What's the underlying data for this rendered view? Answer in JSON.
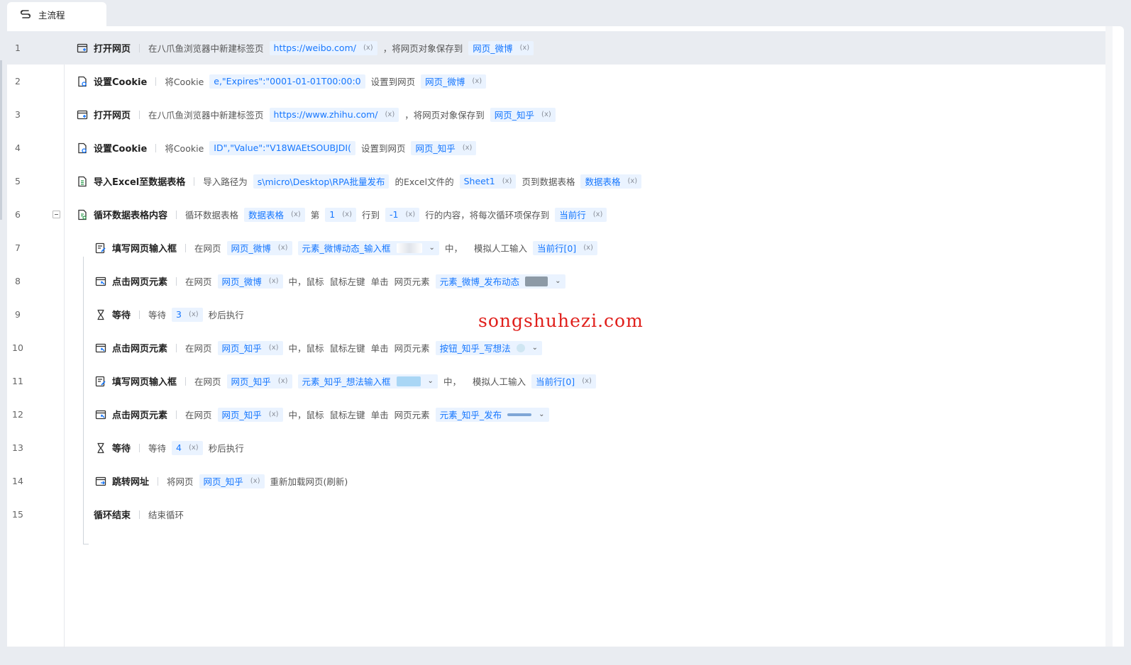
{
  "tab": {
    "label": "主流程"
  },
  "watermark": "songshuhezi.com",
  "rows": [
    {
      "num": "1",
      "title": "打开网页",
      "icon": "open-webpage-icon",
      "selected": true,
      "p1": "在八爪鱼浏览器中新建标签页",
      "c1": "https://weibo.com/",
      "p2": "，将网页对象保存到",
      "c2": "网页_微博"
    },
    {
      "num": "2",
      "title": "设置Cookie",
      "icon": "set-cookie-icon",
      "p1": "将Cookie",
      "c1": "e,\"Expires\":\"0001-01-01T00:00:0",
      "p2": "设置到网页",
      "c2": "网页_微博"
    },
    {
      "num": "3",
      "title": "打开网页",
      "icon": "open-webpage-icon",
      "p1": "在八爪鱼浏览器中新建标签页",
      "c1": "https://www.zhihu.com/",
      "p2": "，将网页对象保存到",
      "c2": "网页_知乎"
    },
    {
      "num": "4",
      "title": "设置Cookie",
      "icon": "set-cookie-icon",
      "p1": "将Cookie",
      "c1": "ID\",\"Value\":\"V18WAEtSOUBJDI(",
      "p2": "设置到网页",
      "c2": "网页_知乎"
    },
    {
      "num": "5",
      "title": "导入Excel至数据表格",
      "icon": "excel-import-icon",
      "p1": "导入路径为",
      "c1": "s\\micro\\Desktop\\RPA批量发布",
      "p2": "的Excel文件的",
      "c2": "Sheet1",
      "p3": "页到数据表格",
      "c3": "数据表格"
    },
    {
      "num": "6",
      "title": "循环数据表格内容",
      "icon": "loop-table-icon",
      "p1": "循环数据表格",
      "c1": "数据表格",
      "p2": "第",
      "c2": "1",
      "p3": "行到",
      "c3": "-1",
      "p4": "行的内容，将每次循环项保存到",
      "c4": "当前行"
    },
    {
      "num": "7",
      "title": "填写网页输入框",
      "icon": "fill-input-icon",
      "p1": "在网页",
      "c1": "网页_微博",
      "c2": "元素_微博动态_输入框",
      "p3": "中，",
      "p4": "模拟人工输入",
      "c4": "当前行[0]"
    },
    {
      "num": "8",
      "title": "点击网页元素",
      "icon": "click-element-icon",
      "p1": "在网页",
      "c1": "网页_微博",
      "p2": "中，鼠标",
      "p3": "鼠标左键",
      "p4": "单击",
      "p5": "网页元素",
      "c5": "元素_微博_发布动态"
    },
    {
      "num": "9",
      "title": "等待",
      "icon": "hourglass-icon",
      "p1": "等待",
      "c1": "3",
      "p2": "秒后执行"
    },
    {
      "num": "10",
      "title": "点击网页元素",
      "icon": "click-element-icon",
      "p1": "在网页",
      "c1": "网页_知乎",
      "p2": "中，鼠标",
      "p3": "鼠标左键",
      "p4": "单击",
      "p5": "网页元素",
      "c5": "按钮_知乎_写想法"
    },
    {
      "num": "11",
      "title": "填写网页输入框",
      "icon": "fill-input-icon",
      "p1": "在网页",
      "c1": "网页_知乎",
      "c2": "元素_知乎_想法输入框",
      "p3": "中，",
      "p4": "模拟人工输入",
      "c4": "当前行[0]"
    },
    {
      "num": "12",
      "title": "点击网页元素",
      "icon": "click-element-icon",
      "p1": "在网页",
      "c1": "网页_知乎",
      "p2": "中，鼠标",
      "p3": "鼠标左键",
      "p4": "单击",
      "p5": "网页元素",
      "c5": "元素_知乎_发布"
    },
    {
      "num": "13",
      "title": "等待",
      "icon": "hourglass-icon",
      "p1": "等待",
      "c1": "4",
      "p2": "秒后执行"
    },
    {
      "num": "14",
      "title": "跳转网址",
      "icon": "navigate-url-icon",
      "p1": "将网页",
      "c1": "网页_知乎",
      "p2": "重新加载网页(刷新)"
    },
    {
      "num": "15",
      "title": "循环结束",
      "icon": "",
      "p1": "结束循环"
    }
  ],
  "colors": {
    "accent": "#1677ff",
    "chip_bg": "#eaf3ff",
    "selected_row": "#e9ecf1",
    "watermark": "#e0201c"
  }
}
